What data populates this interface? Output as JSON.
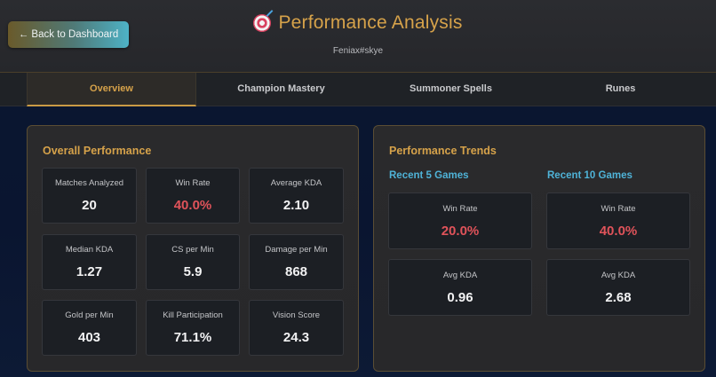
{
  "header": {
    "back_label": "← Back to Dashboard",
    "title": "Performance Analysis",
    "title_icon": "target-icon",
    "subtitle": "Feniax#skye"
  },
  "tabs": [
    {
      "label": "Overview",
      "active": true
    },
    {
      "label": "Champion Mastery",
      "active": false
    },
    {
      "label": "Summoner Spells",
      "active": false
    },
    {
      "label": "Runes",
      "active": false
    }
  ],
  "overall": {
    "title": "Overall Performance",
    "stats": [
      {
        "label": "Matches Analyzed",
        "value": "20"
      },
      {
        "label": "Win Rate",
        "value": "40.0%"
      },
      {
        "label": "Average KDA",
        "value": "2.10"
      },
      {
        "label": "Median KDA",
        "value": "1.27"
      },
      {
        "label": "CS per Min",
        "value": "5.9"
      },
      {
        "label": "Damage per Min",
        "value": "868"
      },
      {
        "label": "Gold per Min",
        "value": "403"
      },
      {
        "label": "Kill Participation",
        "value": "71.1%"
      },
      {
        "label": "Vision Score",
        "value": "24.3"
      }
    ]
  },
  "trends": {
    "title": "Performance Trends",
    "recent5": {
      "heading": "Recent 5 Games",
      "win_rate_label": "Win Rate",
      "win_rate": "20.0%",
      "kda_label": "Avg KDA",
      "kda": "0.96"
    },
    "recent10": {
      "heading": "Recent 10 Games",
      "win_rate_label": "Win Rate",
      "win_rate": "40.0%",
      "kda_label": "Avg KDA",
      "kda": "2.68"
    }
  },
  "colors": {
    "accent_gold": "#d6a24a",
    "accent_blue": "#4fb3d8",
    "value_red": "#e0535a"
  }
}
